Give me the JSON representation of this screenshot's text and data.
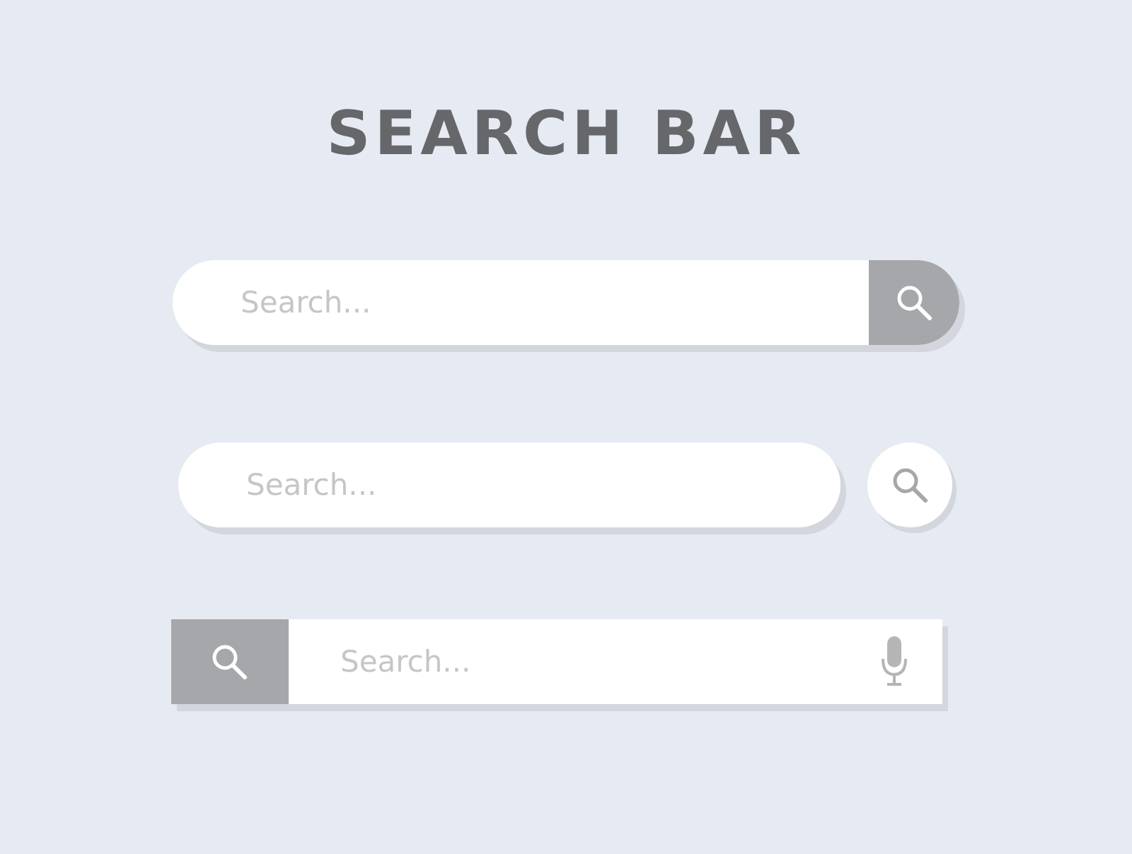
{
  "title": "SEARCH BAR",
  "search_bars": [
    {
      "kind": "attached",
      "placeholder": "Search..."
    },
    {
      "kind": "separate",
      "placeholder": "Search..."
    },
    {
      "kind": "square",
      "placeholder": "Search..."
    }
  ]
}
